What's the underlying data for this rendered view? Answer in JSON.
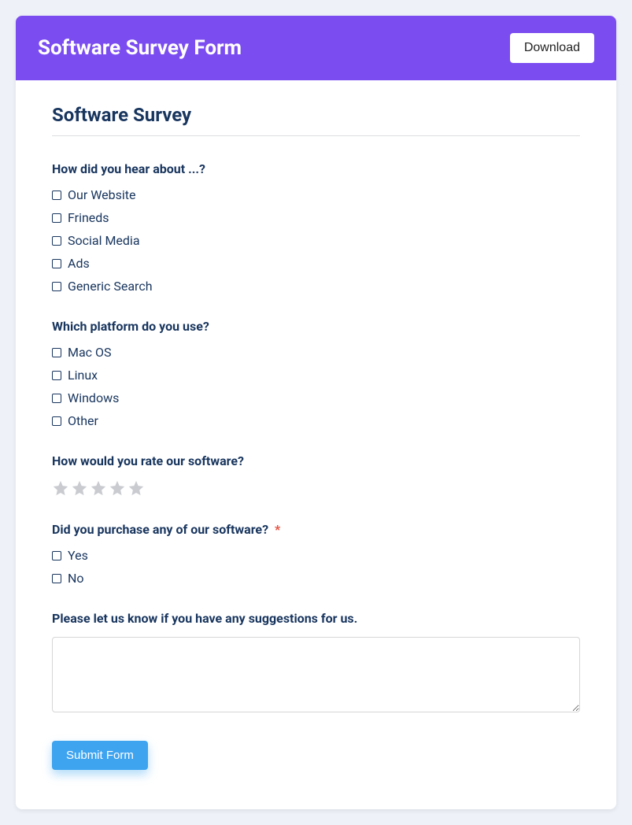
{
  "header": {
    "title": "Software Survey Form",
    "download_label": "Download"
  },
  "form": {
    "title": "Software Survey",
    "q1": {
      "label": "How did you hear about ...?",
      "options": [
        "Our Website",
        "Frineds",
        "Social Media",
        "Ads",
        "Generic Search"
      ]
    },
    "q2": {
      "label": "Which platform do you use?",
      "options": [
        "Mac OS",
        "Linux",
        "Windows",
        "Other"
      ]
    },
    "q3": {
      "label": "How would you rate our software?"
    },
    "q4": {
      "label": "Did you purchase any of our software?",
      "required_marker": "*",
      "options": [
        "Yes",
        "No"
      ]
    },
    "q5": {
      "label": "Please let us know if you have any suggestions for us."
    },
    "submit_label": "Submit Form"
  }
}
